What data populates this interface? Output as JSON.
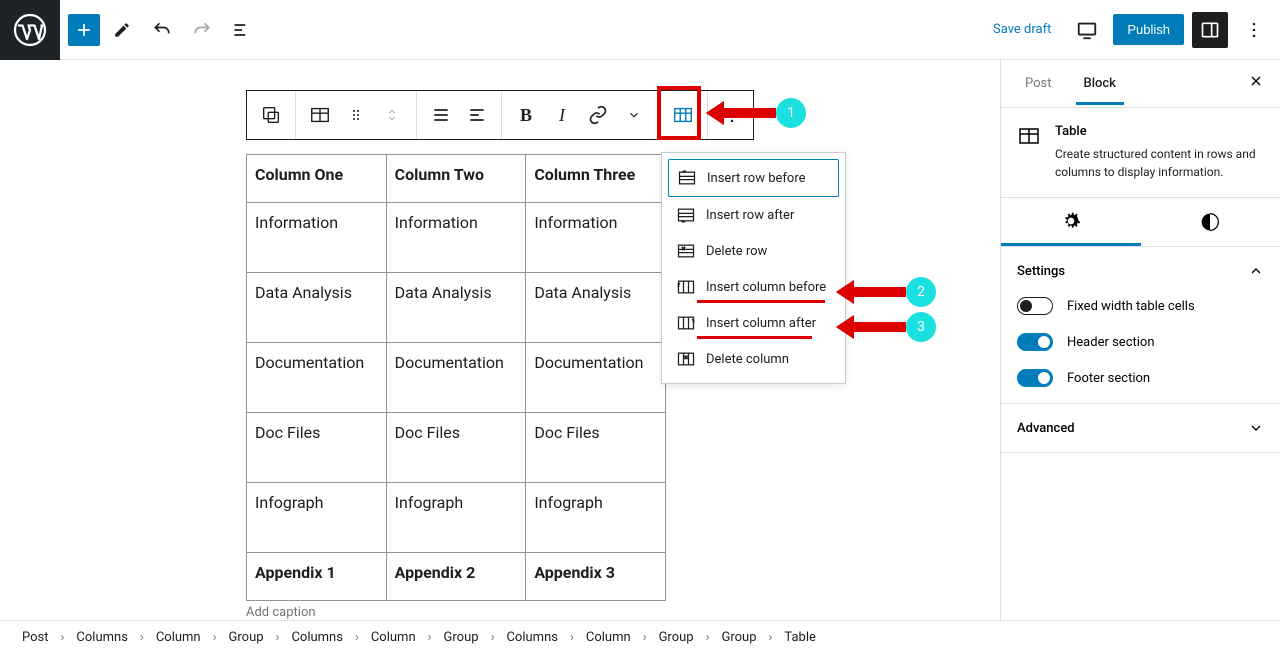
{
  "topbar": {
    "save_draft": "Save draft",
    "publish": "Publish"
  },
  "sidebar": {
    "tabs": {
      "post": "Post",
      "block": "Block"
    },
    "block_title": "Table",
    "block_desc": "Create structured content in rows and columns to display information.",
    "settings_label": "Settings",
    "opt_fixed": "Fixed width table cells",
    "opt_header": "Header section",
    "opt_footer": "Footer section",
    "advanced_label": "Advanced"
  },
  "dropdown": {
    "items": [
      "Insert row before",
      "Insert row after",
      "Delete row",
      "Insert column before",
      "Insert column after",
      "Delete column"
    ]
  },
  "table": {
    "headers": [
      "Column One",
      "Column Two",
      "Column Three"
    ],
    "rows": [
      [
        "Information",
        "Information",
        "Information"
      ],
      [
        "Data Analysis",
        "Data Analysis",
        "Data Analysis"
      ],
      [
        "Documentation",
        "Documentation",
        "Documentation"
      ],
      [
        "Doc Files",
        "Doc Files",
        "Doc Files"
      ],
      [
        "Infograph",
        "Infograph",
        "Infograph"
      ]
    ],
    "footer": [
      "Appendix 1",
      "Appendix 2",
      "Appendix 3"
    ],
    "caption_placeholder": "Add caption"
  },
  "breadcrumb": [
    "Post",
    "Columns",
    "Column",
    "Group",
    "Columns",
    "Column",
    "Group",
    "Columns",
    "Column",
    "Group",
    "Group",
    "Table"
  ],
  "annotations": {
    "b1": "1",
    "b2": "2",
    "b3": "3"
  }
}
